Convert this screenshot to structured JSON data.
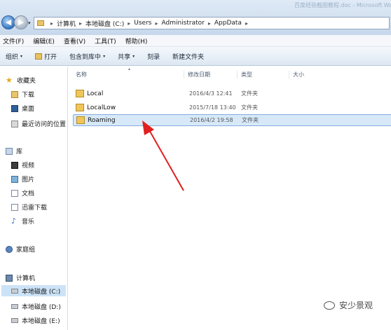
{
  "window": {
    "title": "百度经验截图教程.doc - Microsoft Word"
  },
  "navigation": {
    "back_icon": "back-arrow-icon",
    "forward_icon": "forward-arrow-icon",
    "dropdown": "▾"
  },
  "address": {
    "crumbs": [
      "计算机",
      "本地磁盘 (C:)",
      "Users",
      "Administrator",
      "AppData"
    ],
    "separator": "▸"
  },
  "menu": [
    "文件(F)",
    "编辑(E)",
    "查看(V)",
    "工具(T)",
    "帮助(H)"
  ],
  "toolbar": {
    "organize": "组织",
    "open": "打开",
    "include_in_library": "包含到库中",
    "share": "共享",
    "burn": "刻录",
    "new_folder": "新建文件夹",
    "caret": "▾"
  },
  "sidebar": {
    "favorites": "收藏夹",
    "favorites_items": [
      "下载",
      "桌面",
      "最近访问的位置"
    ],
    "libraries": "库",
    "library_items": [
      "视频",
      "图片",
      "文档",
      "迅雷下载",
      "音乐"
    ],
    "homegroup": "家庭组",
    "computer": "计算机",
    "drives": [
      "本地磁盘 (C:)",
      "本地磁盘 (D:)",
      "本地磁盘 (E:)"
    ],
    "star_glyph": "★",
    "note_glyph": "♪"
  },
  "columns": {
    "name": "名称",
    "modified": "修改日期",
    "type": "类型",
    "size": "大小",
    "sort_glyph": "▴"
  },
  "files": [
    {
      "name": "Local",
      "modified": "2016/4/3 12:41",
      "type": "文件夹",
      "selected": false
    },
    {
      "name": "LocalLow",
      "modified": "2015/7/18 13:40",
      "type": "文件夹",
      "selected": false
    },
    {
      "name": "Roaming",
      "modified": "2016/4/2 19:58",
      "type": "文件夹",
      "selected": true
    }
  ],
  "annotation": {
    "color": "#e02020"
  },
  "watermark": {
    "text": "安少景观",
    "icon": "wechat-icon"
  }
}
